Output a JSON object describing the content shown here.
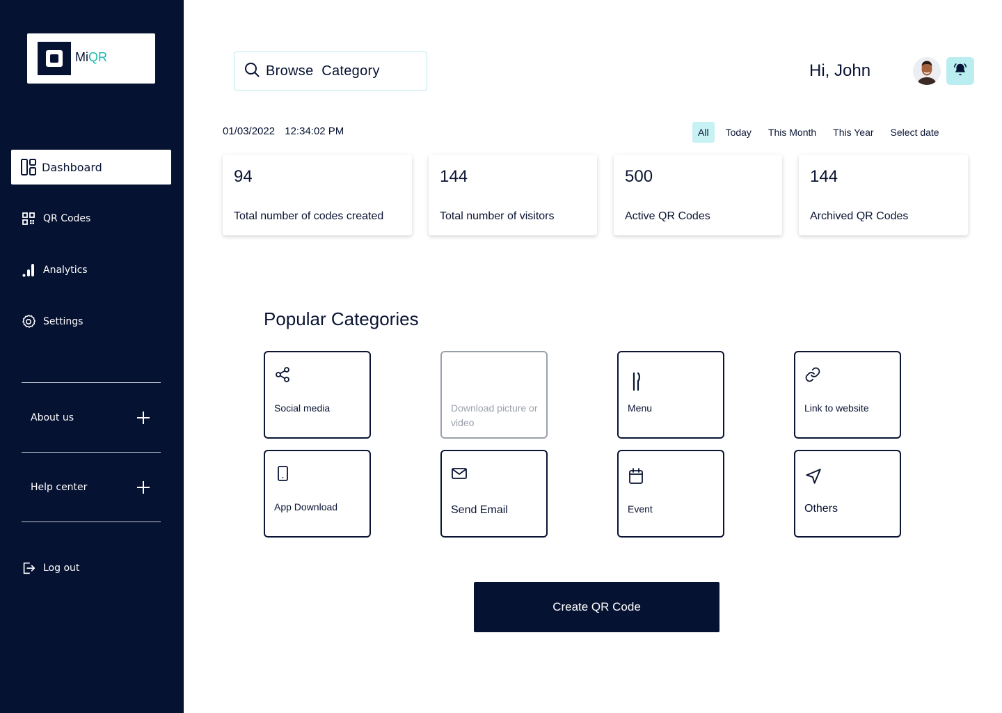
{
  "brand": {
    "name_prefix": "Mi",
    "name_suffix": "QR",
    "accent": "#19b8b0",
    "sidebar_bg": "#061232"
  },
  "sidebar": {
    "items": [
      {
        "label": "Dashboard",
        "icon": "dashboard-icon",
        "active": true
      },
      {
        "label": "QR Codes",
        "icon": "qr-code-icon"
      },
      {
        "label": "Analytics",
        "icon": "analytics-icon"
      },
      {
        "label": "Settings",
        "icon": "gear-icon"
      }
    ],
    "expandables": [
      {
        "label": "About us",
        "icon": "plus-icon"
      },
      {
        "label": "Help center",
        "icon": "plus-icon"
      }
    ],
    "logout_label": "Log out"
  },
  "header": {
    "search_placeholder": "Browse  Category",
    "greeting": "Hi, John"
  },
  "datetime": {
    "date": "01/03/2022",
    "time": "12:34:02 PM"
  },
  "filters": [
    {
      "label": "All",
      "active": true
    },
    {
      "label": "Today"
    },
    {
      "label": "This Month"
    },
    {
      "label": "This Year"
    },
    {
      "label": "Select date"
    }
  ],
  "stats": [
    {
      "value": "94",
      "label": "Total number of codes created"
    },
    {
      "value": "144",
      "label": "Total number of visitors"
    },
    {
      "value": "500",
      "label": "Active QR Codes"
    },
    {
      "value": "144",
      "label": "Archived QR Codes"
    }
  ],
  "categories_title": "Popular Categories",
  "categories": [
    {
      "label": "Social media",
      "icon": "share-icon"
    },
    {
      "label": "Download picture or video",
      "icon": "none",
      "disabled": true
    },
    {
      "label": "Menu",
      "icon": "cutlery-icon"
    },
    {
      "label": "Link to website",
      "icon": "link-icon"
    },
    {
      "label": "App Download",
      "icon": "phone-icon"
    },
    {
      "label": "Send Email",
      "icon": "mail-icon"
    },
    {
      "label": "Event",
      "icon": "calendar-icon"
    },
    {
      "label": "Others",
      "icon": "navigation-icon"
    }
  ],
  "create_button_label": "Create QR Code"
}
